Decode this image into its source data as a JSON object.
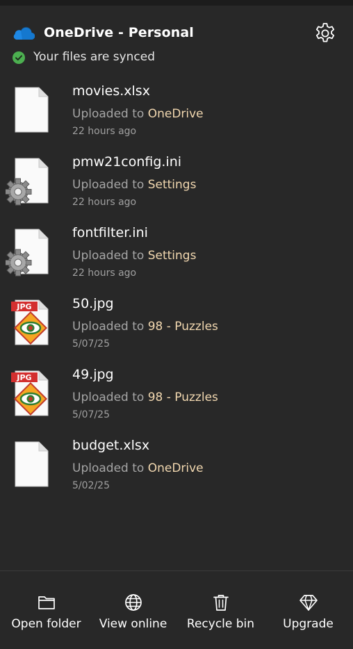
{
  "header": {
    "title": "OneDrive - Personal",
    "status": "Your files are synced"
  },
  "uploaded_prefix": "Uploaded to",
  "files": [
    {
      "name": "movies.xlsx",
      "destination": "OneDrive",
      "time": "22 hours ago",
      "icon": "blank-document-icon"
    },
    {
      "name": "pmw21config.ini",
      "destination": "Settings",
      "time": "22 hours ago",
      "icon": "config-file-icon"
    },
    {
      "name": "fontfilter.ini",
      "destination": "Settings",
      "time": "22 hours ago",
      "icon": "config-file-icon"
    },
    {
      "name": "50.jpg",
      "destination": "98 - Puzzles",
      "time": "5/07/25",
      "icon": "jpg-file-icon"
    },
    {
      "name": "49.jpg",
      "destination": "98 - Puzzles",
      "time": "5/07/25",
      "icon": "jpg-file-icon"
    },
    {
      "name": "budget.xlsx",
      "destination": "OneDrive",
      "time": "5/02/25",
      "icon": "blank-document-icon"
    }
  ],
  "jpg_badge": "JPG",
  "footer": {
    "open_folder": "Open folder",
    "view_online": "View online",
    "recycle_bin": "Recycle bin",
    "upgrade": "Upgrade"
  },
  "colors": {
    "background": "#282828",
    "destination_link": "#f2d8b0",
    "sync_ok": "#4caf50",
    "onedrive_blue": "#1e88e5"
  }
}
